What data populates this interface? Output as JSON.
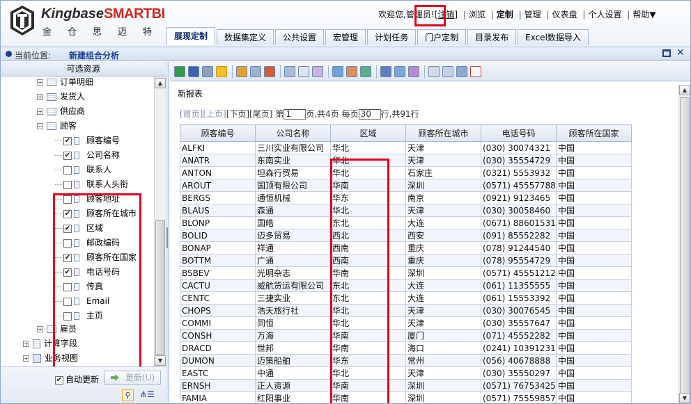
{
  "brand": {
    "name_prefix": "Kingbase",
    "name_suffix": "SMART",
    "name_bi": "BI",
    "subtitle": "金仓思迈特"
  },
  "header": {
    "welcome": "欢迎您,",
    "user": "管理员!",
    "logout": "[注销]",
    "links": [
      "浏览",
      "定制",
      "管理",
      "仪表盘",
      "个人设置",
      "帮助▼"
    ]
  },
  "tabs": [
    "展现定制",
    "数据集定义",
    "公共设置",
    "宏管理",
    "计划任务",
    "门户定制",
    "目录发布",
    "Excel数据导入"
  ],
  "breadcrumb": {
    "label": "当前位置:",
    "value": "新建组合分析"
  },
  "left_panel": {
    "title": "可选资源",
    "tree": {
      "order_detail": "订单明细",
      "shipper": "发货人",
      "supplier": "供应商",
      "customer": "顾客",
      "fields": [
        {
          "label": "顾客编号",
          "checked": true
        },
        {
          "label": "公司名称",
          "checked": true
        },
        {
          "label": "联系人",
          "checked": false
        },
        {
          "label": "联系人头衔",
          "checked": false
        },
        {
          "label": "顾客地址",
          "checked": false
        },
        {
          "label": "顾客所在城市",
          "checked": true
        },
        {
          "label": "区域",
          "checked": true
        },
        {
          "label": "邮政编码",
          "checked": false
        },
        {
          "label": "顾客所在国家",
          "checked": true
        },
        {
          "label": "电话号码",
          "checked": true
        },
        {
          "label": "传真",
          "checked": false
        },
        {
          "label": "Email",
          "checked": false
        },
        {
          "label": "主页",
          "checked": false
        }
      ],
      "employee": "雇员",
      "calc_fields": "计算字段",
      "business_view": "业务视图"
    },
    "auto_update": "自动更新",
    "update_button": "更新(U)",
    "check_mark": "✔"
  },
  "report": {
    "title": "新报表",
    "pager": {
      "first": "[首页]",
      "prev": "[上页]",
      "next": "[下页]",
      "last": "[尾页]",
      "page_prefix": "第",
      "page_value": "1",
      "page_suffix": "页,共4页 每页",
      "size_value": "30",
      "size_suffix": "行,共91行"
    },
    "columns": [
      "顾客编号",
      "公司名称",
      "区域",
      "顾客所在城市",
      "电话号码",
      "顾客所在国家"
    ],
    "rows": [
      [
        "ALFKI",
        "三川实业有限公司",
        "华北",
        "天津",
        "(030) 30074321",
        "中国"
      ],
      [
        "ANATR",
        "东南实业",
        "华北",
        "天津",
        "(030) 35554729",
        "中国"
      ],
      [
        "ANTON",
        "坦森行贸易",
        "华北",
        "石家庄",
        "(0321) 5553932",
        "中国"
      ],
      [
        "AROUT",
        "国顶有限公司",
        "华南",
        "深圳",
        "(0571) 45557788",
        "中国"
      ],
      [
        "BERGS",
        "通恒机械",
        "华东",
        "南京",
        "(0921) 9123465",
        "中国"
      ],
      [
        "BLAUS",
        "森通",
        "华北",
        "天津",
        "(030) 30058460",
        "中国"
      ],
      [
        "BLONP",
        "国皓",
        "东北",
        "大连",
        "(0671) 88601531",
        "中国"
      ],
      [
        "BOLID",
        "迈多贸易",
        "西北",
        "西安",
        "(091) 85552282",
        "中国"
      ],
      [
        "BONAP",
        "祥通",
        "西南",
        "重庆",
        "(078) 91244540",
        "中国"
      ],
      [
        "BOTTM",
        "广通",
        "西南",
        "重庆",
        "(078) 95554729",
        "中国"
      ],
      [
        "BSBEV",
        "光明杂志",
        "华南",
        "深圳",
        "(0571) 45551212",
        "中国"
      ],
      [
        "CACTU",
        "威航货运有限公司",
        "东北",
        "大连",
        "(061) 11355555",
        "中国"
      ],
      [
        "CENTC",
        "三捷实业",
        "东北",
        "大连",
        "(061) 15553392",
        "中国"
      ],
      [
        "CHOPS",
        "浩天旅行社",
        "华北",
        "天津",
        "(030) 30076545",
        "中国"
      ],
      [
        "COMMI",
        "同恒",
        "华北",
        "天津",
        "(030) 35557647",
        "中国"
      ],
      [
        "CONSH",
        "万海",
        "华南",
        "厦门",
        "(071) 45552282",
        "中国"
      ],
      [
        "DRACD",
        "世邦",
        "华南",
        "海口",
        "(0241) 10391231",
        "中国"
      ],
      [
        "DUMON",
        "迈策船舶",
        "华东",
        "常州",
        "(056) 40678888",
        "中国"
      ],
      [
        "EASTC",
        "中通",
        "华北",
        "天津",
        "(030) 35550297",
        "中国"
      ],
      [
        "ERNSH",
        "正人资源",
        "华南",
        "深圳",
        "(0571) 76753425",
        "中国"
      ],
      [
        "FAMIA",
        "红阳事业",
        "华南",
        "深圳",
        "(0571) 75559857",
        "中国"
      ]
    ]
  },
  "scroll": {
    "up": "▲",
    "down": "▼"
  }
}
